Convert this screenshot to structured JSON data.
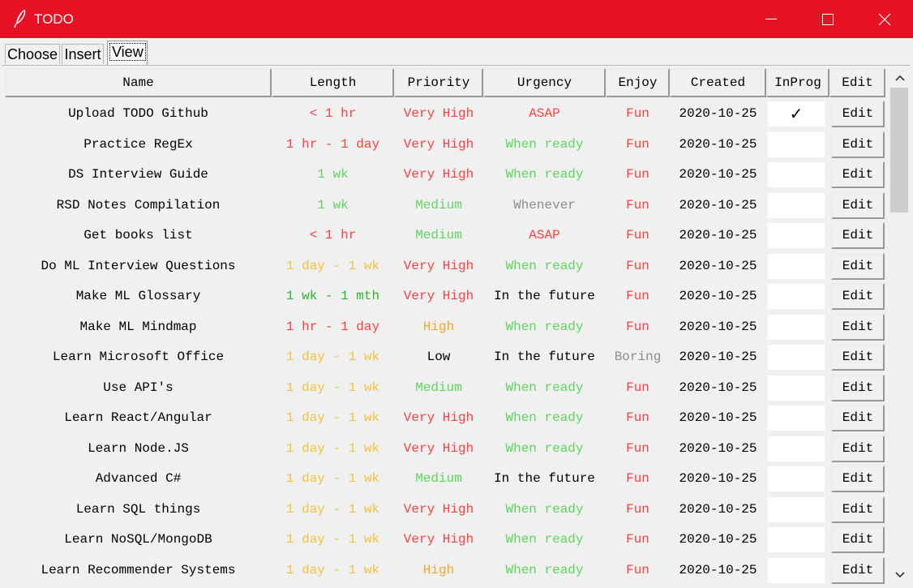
{
  "window": {
    "title": "TODO"
  },
  "tabs": [
    "Choose",
    "Insert",
    "View"
  ],
  "columns": [
    "Name",
    "Length",
    "Priority",
    "Urgency",
    "Enjoy",
    "Created",
    "InProg",
    "Edit"
  ],
  "colors": {
    "titlebar": "#e81123",
    "red": "#ff4040",
    "green": "#2db52d",
    "light_green": "#5cd65c",
    "yellow": "#f5c23d",
    "orange": "#f5a623",
    "gray": "#8c8c8c",
    "black": "#000000"
  },
  "rows": [
    {
      "name": "Upload TODO Github",
      "length": "< 1 hr",
      "length_color": "red",
      "priority": "Very High",
      "priority_color": "red",
      "urgency": "ASAP",
      "urgency_color": "red",
      "enjoy": "Fun",
      "enjoy_color": "red",
      "created": "2020-10-25",
      "inprog": "✓",
      "edit": "Edit"
    },
    {
      "name": "Practice RegEx",
      "length": "1 hr - 1 day",
      "length_color": "red",
      "priority": "Very High",
      "priority_color": "red",
      "urgency": "When ready",
      "urgency_color": "light_green",
      "enjoy": "Fun",
      "enjoy_color": "red",
      "created": "2020-10-25",
      "inprog": "",
      "edit": "Edit"
    },
    {
      "name": "DS Interview Guide",
      "length": "1 wk",
      "length_color": "light_green",
      "priority": "Very High",
      "priority_color": "red",
      "urgency": "When ready",
      "urgency_color": "light_green",
      "enjoy": "Fun",
      "enjoy_color": "red",
      "created": "2020-10-25",
      "inprog": "",
      "edit": "Edit"
    },
    {
      "name": "RSD Notes Compilation",
      "length": "1 wk",
      "length_color": "light_green",
      "priority": "Medium",
      "priority_color": "light_green",
      "urgency": "Whenever",
      "urgency_color": "gray",
      "enjoy": "Fun",
      "enjoy_color": "red",
      "created": "2020-10-25",
      "inprog": "",
      "edit": "Edit"
    },
    {
      "name": "Get books list",
      "length": "< 1 hr",
      "length_color": "red",
      "priority": "Medium",
      "priority_color": "light_green",
      "urgency": "ASAP",
      "urgency_color": "red",
      "enjoy": "Fun",
      "enjoy_color": "red",
      "created": "2020-10-25",
      "inprog": "",
      "edit": "Edit"
    },
    {
      "name": "Do ML Interview Questions",
      "length": "1 day - 1 wk",
      "length_color": "yellow",
      "priority": "Very High",
      "priority_color": "red",
      "urgency": "When ready",
      "urgency_color": "light_green",
      "enjoy": "Fun",
      "enjoy_color": "red",
      "created": "2020-10-25",
      "inprog": "",
      "edit": "Edit"
    },
    {
      "name": "Make ML Glossary",
      "length": "1 wk - 1 mth",
      "length_color": "green",
      "priority": "Very High",
      "priority_color": "red",
      "urgency": "In the future",
      "urgency_color": "black",
      "enjoy": "Fun",
      "enjoy_color": "red",
      "created": "2020-10-25",
      "inprog": "",
      "edit": "Edit"
    },
    {
      "name": "Make ML Mindmap",
      "length": "1 hr - 1 day",
      "length_color": "red",
      "priority": "High",
      "priority_color": "orange",
      "urgency": "When ready",
      "urgency_color": "light_green",
      "enjoy": "Fun",
      "enjoy_color": "red",
      "created": "2020-10-25",
      "inprog": "",
      "edit": "Edit"
    },
    {
      "name": "Learn Microsoft Office",
      "length": "1 day - 1 wk",
      "length_color": "yellow",
      "priority": "Low",
      "priority_color": "black",
      "urgency": "In the future",
      "urgency_color": "black",
      "enjoy": "Boring",
      "enjoy_color": "gray",
      "created": "2020-10-25",
      "inprog": "",
      "edit": "Edit"
    },
    {
      "name": "Use API's",
      "length": "1 day - 1 wk",
      "length_color": "yellow",
      "priority": "Medium",
      "priority_color": "light_green",
      "urgency": "When ready",
      "urgency_color": "light_green",
      "enjoy": "Fun",
      "enjoy_color": "red",
      "created": "2020-10-25",
      "inprog": "",
      "edit": "Edit"
    },
    {
      "name": "Learn React/Angular",
      "length": "1 day - 1 wk",
      "length_color": "yellow",
      "priority": "Very High",
      "priority_color": "red",
      "urgency": "When ready",
      "urgency_color": "light_green",
      "enjoy": "Fun",
      "enjoy_color": "red",
      "created": "2020-10-25",
      "inprog": "",
      "edit": "Edit"
    },
    {
      "name": "Learn Node.JS",
      "length": "1 day - 1 wk",
      "length_color": "yellow",
      "priority": "Very High",
      "priority_color": "red",
      "urgency": "When ready",
      "urgency_color": "light_green",
      "enjoy": "Fun",
      "enjoy_color": "red",
      "created": "2020-10-25",
      "inprog": "",
      "edit": "Edit"
    },
    {
      "name": "Advanced C#",
      "length": "1 day - 1 wk",
      "length_color": "yellow",
      "priority": "Medium",
      "priority_color": "light_green",
      "urgency": "In the future",
      "urgency_color": "black",
      "enjoy": "Fun",
      "enjoy_color": "red",
      "created": "2020-10-25",
      "inprog": "",
      "edit": "Edit"
    },
    {
      "name": "Learn SQL things",
      "length": "1 day - 1 wk",
      "length_color": "yellow",
      "priority": "Very High",
      "priority_color": "red",
      "urgency": "When ready",
      "urgency_color": "light_green",
      "enjoy": "Fun",
      "enjoy_color": "red",
      "created": "2020-10-25",
      "inprog": "",
      "edit": "Edit"
    },
    {
      "name": "Learn NoSQL/MongoDB",
      "length": "1 day - 1 wk",
      "length_color": "yellow",
      "priority": "Very High",
      "priority_color": "red",
      "urgency": "When ready",
      "urgency_color": "light_green",
      "enjoy": "Fun",
      "enjoy_color": "red",
      "created": "2020-10-25",
      "inprog": "",
      "edit": "Edit"
    },
    {
      "name": "Learn Recommender Systems",
      "length": "1 day - 1 wk",
      "length_color": "yellow",
      "priority": "High",
      "priority_color": "orange",
      "urgency": "When ready",
      "urgency_color": "light_green",
      "enjoy": "Fun",
      "enjoy_color": "red",
      "created": "2020-10-25",
      "inprog": "",
      "edit": "Edit"
    }
  ]
}
